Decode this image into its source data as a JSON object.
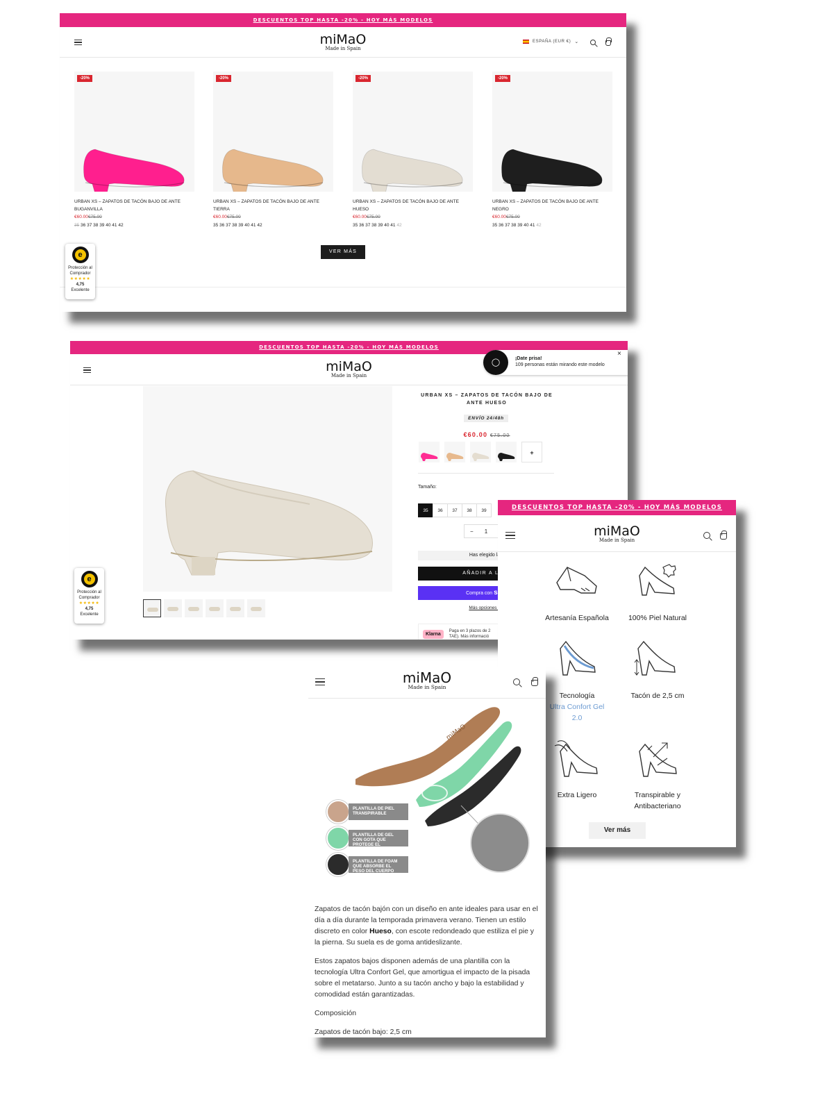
{
  "promo_text": "DESCUENTOS TOP HASTA -20% - HOY MÁS MODELOS",
  "brand": {
    "name": "miMaO",
    "tagline": "Made in Spain"
  },
  "listing": {
    "country": "ESPAÑA (EUR €)",
    "products": [
      {
        "badge": "-20%",
        "title_line1": "URBAN XS – ZAPATOS DE TACÓN BAJO DE ANTE",
        "title_line2": "BUGANVILLA",
        "price": "€60.00",
        "old_price": "€75.00",
        "color": "#ff1f8e",
        "sizes": [
          [
            "35",
            "out"
          ],
          [
            "36",
            ""
          ],
          [
            "37",
            ""
          ],
          [
            "38",
            ""
          ],
          [
            "39",
            ""
          ],
          [
            "40",
            ""
          ],
          [
            "41",
            ""
          ],
          [
            "42",
            ""
          ]
        ]
      },
      {
        "badge": "-20%",
        "title_line1": "URBAN XS – ZAPATOS DE TACÓN BAJO DE ANTE",
        "title_line2": "TIERRA",
        "price": "€60.00",
        "old_price": "€75.00",
        "color": "#e6b88c",
        "sizes": [
          [
            "35",
            ""
          ],
          [
            "36",
            ""
          ],
          [
            "37",
            ""
          ],
          [
            "38",
            ""
          ],
          [
            "39",
            ""
          ],
          [
            "40",
            ""
          ],
          [
            "41",
            ""
          ],
          [
            "42",
            ""
          ]
        ]
      },
      {
        "badge": "-20%",
        "title_line1": "URBAN XS – ZAPATOS DE TACÓN BAJO DE ANTE",
        "title_line2": "HUESO",
        "price": "€60.00",
        "old_price": "€75.00",
        "color": "#e3ddd2",
        "sizes": [
          [
            "35",
            ""
          ],
          [
            "36",
            ""
          ],
          [
            "37",
            ""
          ],
          [
            "38",
            ""
          ],
          [
            "39",
            ""
          ],
          [
            "40",
            ""
          ],
          [
            "41",
            ""
          ],
          [
            "42",
            "grey"
          ]
        ]
      },
      {
        "badge": "-20%",
        "title_line1": "URBAN XS – ZAPATOS DE TACÓN BAJO DE ANTE",
        "title_line2": "NEGRO",
        "price": "€60.00",
        "old_price": "€75.00",
        "color": "#1e1e1e",
        "sizes": [
          [
            "35",
            ""
          ],
          [
            "36",
            ""
          ],
          [
            "37",
            ""
          ],
          [
            "38",
            ""
          ],
          [
            "39",
            ""
          ],
          [
            "40",
            ""
          ],
          [
            "41",
            ""
          ],
          [
            "42",
            "grey"
          ]
        ]
      }
    ],
    "more_button": "VER MÁS"
  },
  "trust": {
    "label_1": "Protección al",
    "label_2": "Comprador",
    "stars": "★★★★★",
    "rating": "4,75",
    "verdict": "Excelente"
  },
  "product": {
    "title_line1": "URBAN XS – ZAPATOS DE TACÓN BAJO DE",
    "title_line2": "ANTE HUESO",
    "shipping": "ENVÍO 24/48h",
    "price": "€60.00",
    "old_price": "€75.00",
    "swatch_colors": [
      "#ff2d93",
      "#e7b98d",
      "#e4ddd0",
      "#1c1c1c"
    ],
    "more_swatch": "+",
    "size_label": "Tamaño:",
    "sizes": [
      "35",
      "36",
      "37",
      "38",
      "39"
    ],
    "qty_minus": "−",
    "qty": "1",
    "qty_plus": "+",
    "chosen_text": "Has elegido la t",
    "add_button": "AÑADIR A LA C",
    "shop_pay": "Compra con",
    "shop_pay_brand": "sho",
    "more_options": "Más opciones de",
    "klarna_logo": "Klarna",
    "klarna_line1": "Paga en 3 plazos de 2",
    "klarna_line2": "TAE). Más informació",
    "popup_title": "¡Date prisa!",
    "popup_text": "109 personas están mirando este modelo",
    "popup_close": "×"
  },
  "features": {
    "items": [
      {
        "lines": [
          "Artesanía Española"
        ]
      },
      {
        "lines": [
          "100% Piel Natural"
        ]
      },
      {
        "lines": [
          "Tecnología"
        ],
        "highlight": [
          "Ultra Confort Gel",
          "2.0"
        ]
      },
      {
        "lines": [
          "Tacón de 2,5 cm"
        ]
      },
      {
        "lines": [
          "Extra Ligero"
        ]
      },
      {
        "lines": [
          "Transpirable y",
          "Antibacteriano"
        ]
      }
    ],
    "more_button": "Ver más"
  },
  "insole": {
    "layers": [
      {
        "label": "PLANTILLA DE PIEL TRANSPIRABLE",
        "color": "#c9a48c"
      },
      {
        "label": "PLANTILLA DE GEL CON GOTA QUE PROTEGE EL METATARSO",
        "color": "#7fd6a8"
      },
      {
        "label": "PLANTILLA DE FOAM QUE ABSORBE EL PESO DEL CUERPO",
        "color": "#2b2b2b"
      }
    ],
    "stamp": "miMaO"
  },
  "description": {
    "p1_pre": "Zapatos de tacón bajón con un diseño en ante ideales para usar en el día a día durante la temporada primavera verano. Tienen un estilo discreto en color ",
    "p1_bold": "Hueso",
    "p1_post": ", con escote redondeado que estiliza el pie y la pierna. Su suela es de goma antideslizante.",
    "p2": "Estos zapatos bajos disponen además de una plantilla con la tecnología Ultra Confort Gel, que amortigua el impacto de la pisada sobre el metatarso. Junto a su tacón ancho y bajo la estabilidad y comodidad están garantizadas.",
    "p3": "Composición",
    "p4": "Zapatos de tacón bajo: 2,5 cm"
  }
}
